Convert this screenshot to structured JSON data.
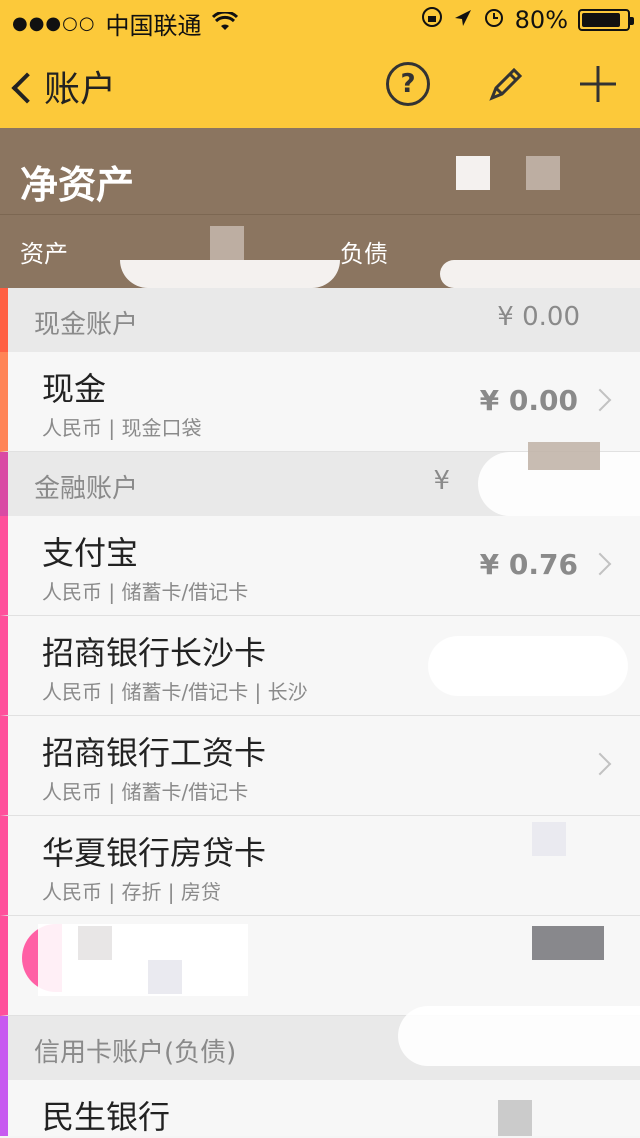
{
  "status": {
    "signal_dots": "●●●○○",
    "carrier": "中国联通",
    "battery_pct": "80%"
  },
  "nav": {
    "back_label": "账户",
    "help_label": "?"
  },
  "summary": {
    "title": "净资产",
    "asset_label": "资产",
    "debt_label": "负债"
  },
  "categories": [
    {
      "name": "现金账户",
      "amount": "¥ 0.00"
    },
    {
      "name": "金融账户",
      "amount": "¥"
    },
    {
      "name": "信用卡账户(负债)",
      "amount": ""
    }
  ],
  "accounts": [
    {
      "name": "现金",
      "meta": "人民币 | 现金口袋",
      "balance": "¥ 0.00"
    },
    {
      "name": "支付宝",
      "meta": "人民币 | 储蓄卡/借记卡",
      "balance": "¥ 0.76"
    },
    {
      "name": "招商银行长沙卡",
      "meta": "人民币 | 储蓄卡/借记卡 | 长沙",
      "balance": ""
    },
    {
      "name": "招商银行工资卡",
      "meta": "人民币 | 储蓄卡/借记卡",
      "balance": ""
    },
    {
      "name": "华夏银行房贷卡",
      "meta": "人民币 | 存折 | 房贷",
      "balance": ""
    },
    {
      "name": "民生银行",
      "meta": "",
      "balance": ""
    }
  ],
  "colors": {
    "accent_yellow": "#fcc93a",
    "summary_bg": "#8b7560"
  }
}
